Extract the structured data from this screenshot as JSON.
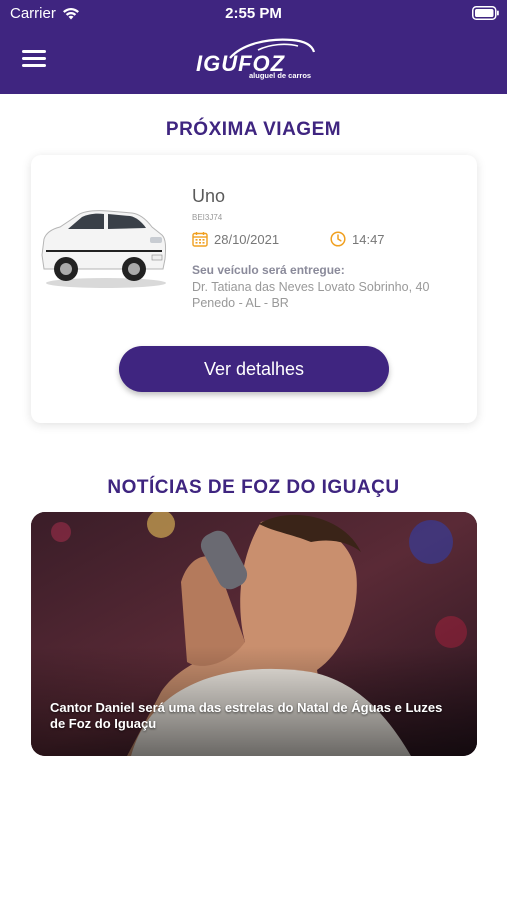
{
  "status_bar": {
    "carrier": "Carrier",
    "time": "2:55 PM"
  },
  "header": {
    "logo_text": "IGUFOZ",
    "logo_subtitle": "aluguel de carros",
    "background_color": "#3f2580"
  },
  "next_trip": {
    "section_title": "PRÓXIMA VIAGEM",
    "car_model": "Uno",
    "plate": "BEI3J74",
    "date": "28/10/2021",
    "time": "14:47",
    "delivery_label": "Seu veículo será entregue:",
    "address_line1": "Dr. Tatiana das Neves Lovato Sobrinho, 40",
    "address_line2": "Penedo - AL - BR",
    "button_label": "Ver detalhes"
  },
  "news": {
    "section_title": "NOTÍCIAS DE FOZ DO IGUAÇU",
    "items": [
      {
        "caption": "Cantor Daniel será uma das estrelas do Natal de Águas e Luzes de Foz do Iguaçu"
      }
    ]
  },
  "icons": {
    "menu": "hamburger-menu-icon",
    "calendar": "calendar-icon",
    "clock": "clock-icon",
    "wifi": "wifi-icon",
    "battery": "battery-icon"
  },
  "colors": {
    "brand": "#3f2580",
    "accent_icon": "#f0a020"
  }
}
